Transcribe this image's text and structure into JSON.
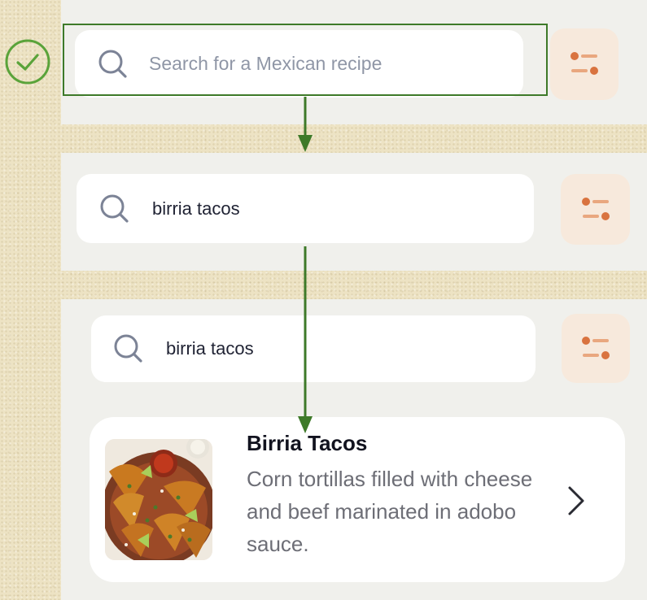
{
  "step1": {
    "search_placeholder": "Search for a Mexican recipe",
    "status": "check-icon"
  },
  "step2": {
    "search_value": "birria tacos"
  },
  "step3": {
    "search_value": "birria tacos",
    "result": {
      "title": "Birria Tacos",
      "description": "Corn tortillas filled with cheese and beef marinated in adobo sauce."
    }
  },
  "colors": {
    "accent_green": "#3e7a29",
    "filter_orange": "#d9733f",
    "filter_bg": "#f7e9dc",
    "panel_bg": "#f0f0ec"
  }
}
